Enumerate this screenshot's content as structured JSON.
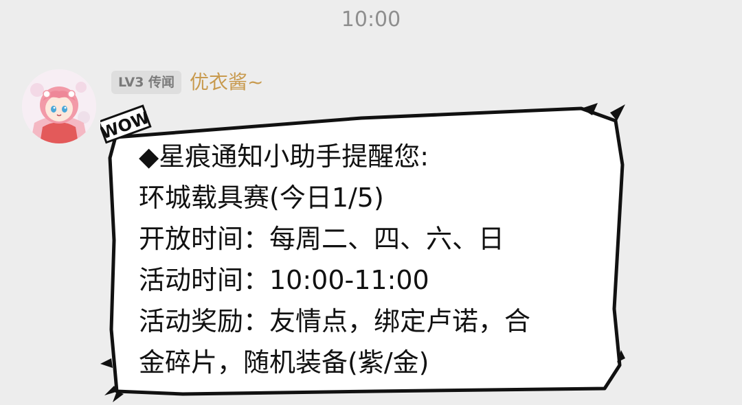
{
  "timestamp": "10:00",
  "sender": {
    "level_badge": "LV3 传闻",
    "name": "优衣酱~"
  },
  "bubble": {
    "sticker": "WOW",
    "lines": [
      "◆星痕通知小助手提醒您:",
      "环城载具赛(今日1/5)",
      "开放时间：每周二、四、六、日",
      "活动时间：10:00-11:00",
      "活动奖励：友情点，绑定卢诺，合",
      "金碎片，随机装备(紫/金)"
    ]
  },
  "colors": {
    "background": "#ededed",
    "timestamp": "#8e8e8e",
    "sender_name": "#c89a4e",
    "badge_bg": "#dedede",
    "badge_text": "#7a7a7a",
    "bubble_fill": "#ffffff",
    "bubble_border": "#111111"
  },
  "icons": {
    "avatar": "anime-girl-avatar",
    "bubble_frame": "comic-speech-bubble-frame"
  }
}
